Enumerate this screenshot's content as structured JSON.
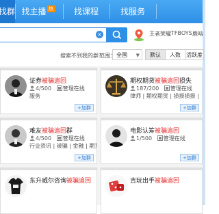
{
  "tabs": [
    {
      "label": "找群",
      "display": "找群"
    },
    {
      "label": "找主播",
      "badge": "热"
    },
    {
      "label": "找课程"
    },
    {
      "label": "找服务"
    }
  ],
  "search": {
    "value": "",
    "placeholder": ""
  },
  "hot_words": [
    "王者荣耀",
    "TFBOYS",
    "鹿晗"
  ],
  "filter": {
    "hint": "搜索不到我的群？",
    "range_label": "范围：",
    "scope_value": "全国",
    "sort_options": [
      "默认",
      "人数",
      "活跃度"
    ]
  },
  "join_label": "+加群",
  "groups": [
    {
      "title_prefix": "证券",
      "title_red": "被骗追回",
      "title_suffix": "",
      "members": "4/500",
      "category": "管理在线",
      "tags": "服务",
      "avatar": "person-icon"
    },
    {
      "title_prefix": "期权期货",
      "title_red": "被骗追回",
      "title_suffix": "损失",
      "members": "187/200",
      "category": "管理在线",
      "tags": "律师 | 期权期货 | 损损损损 | 外汇",
      "avatar": "scales-icon"
    },
    {
      "title_prefix": "难友",
      "title_red": "被骗追回",
      "title_suffix": "群",
      "members": "4/500",
      "category": "管理在线",
      "tags": "行业资讯 | 被骗 | 金融 | 期货",
      "avatar": "person-icon"
    },
    {
      "title_prefix": "电影认筹",
      "title_red": "被骗追回",
      "title_suffix": "",
      "members": "1/500",
      "category": "管理在线",
      "tags": "",
      "avatar": "person-icon"
    },
    {
      "title_prefix": "东升威尔咨询",
      "title_red": "被骗追回",
      "title_suffix": "",
      "members": "",
      "category": "",
      "tags": "",
      "avatar": "shirt-icon"
    },
    {
      "title_prefix": "吉玩出手",
      "title_red": "被骗追回",
      "title_suffix": "",
      "members": "",
      "category": "",
      "tags": "",
      "avatar": "dice-icon"
    }
  ],
  "colors": {
    "tab_bar": "#2e8fe6",
    "highlight": "#e62e2e",
    "join_button": "#2e7fd6"
  }
}
